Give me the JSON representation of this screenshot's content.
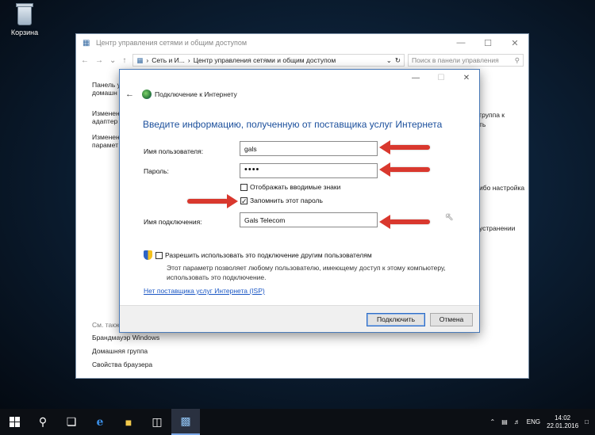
{
  "desktop": {
    "recycle_bin_label": "Корзина"
  },
  "bg_window": {
    "title": "Центр управления сетями и общим доступом",
    "breadcrumb_parent": "Сеть и И...",
    "breadcrumb_current": "Центр управления сетями и общим доступом",
    "search_placeholder": "Поиск в панели управления",
    "sidebar_lines": [
      "Панель у",
      "домашн",
      "Изменен",
      "адаптер",
      "Изменен",
      "парамет"
    ],
    "right_lines": [
      "группа к",
      "ть",
      "ибо настройка",
      "устранении"
    ],
    "see_also": "См. также",
    "links": [
      "Брандмауэр Windows",
      "Домашняя группа",
      "Свойства браузера"
    ]
  },
  "dialog": {
    "nav_title": "Подключение к Интернету",
    "heading": "Введите информацию, полученную от поставщика услуг Интернета",
    "username_label": "Имя пользователя:",
    "username_value": "gals",
    "password_label": "Пароль:",
    "password_value": "••••",
    "show_chars_label": "Отображать вводимые знаки",
    "remember_label": "Запомнить этот пароль",
    "connection_name_label": "Имя подключения:",
    "connection_name_value": "Gals Telecom",
    "allow_others_label": "Разрешить использовать это подключение другим пользователям",
    "allow_desc_line1": "Этот параметр позволяет любому пользователю, имеющему доступ к этому компьютеру,",
    "allow_desc_line2": "использовать это подключение.",
    "no_isp_link": "Нет поставщика услуг Интернета (ISP)",
    "connect_button": "Подключить",
    "cancel_button": "Отмена"
  },
  "taskbar": {
    "language": "ENG",
    "time": "14:02",
    "date": "22.01.2016"
  },
  "colors": {
    "heading_blue": "#1b4f9c",
    "arrow_red": "#d9382e",
    "link_blue": "#1a56c4"
  }
}
